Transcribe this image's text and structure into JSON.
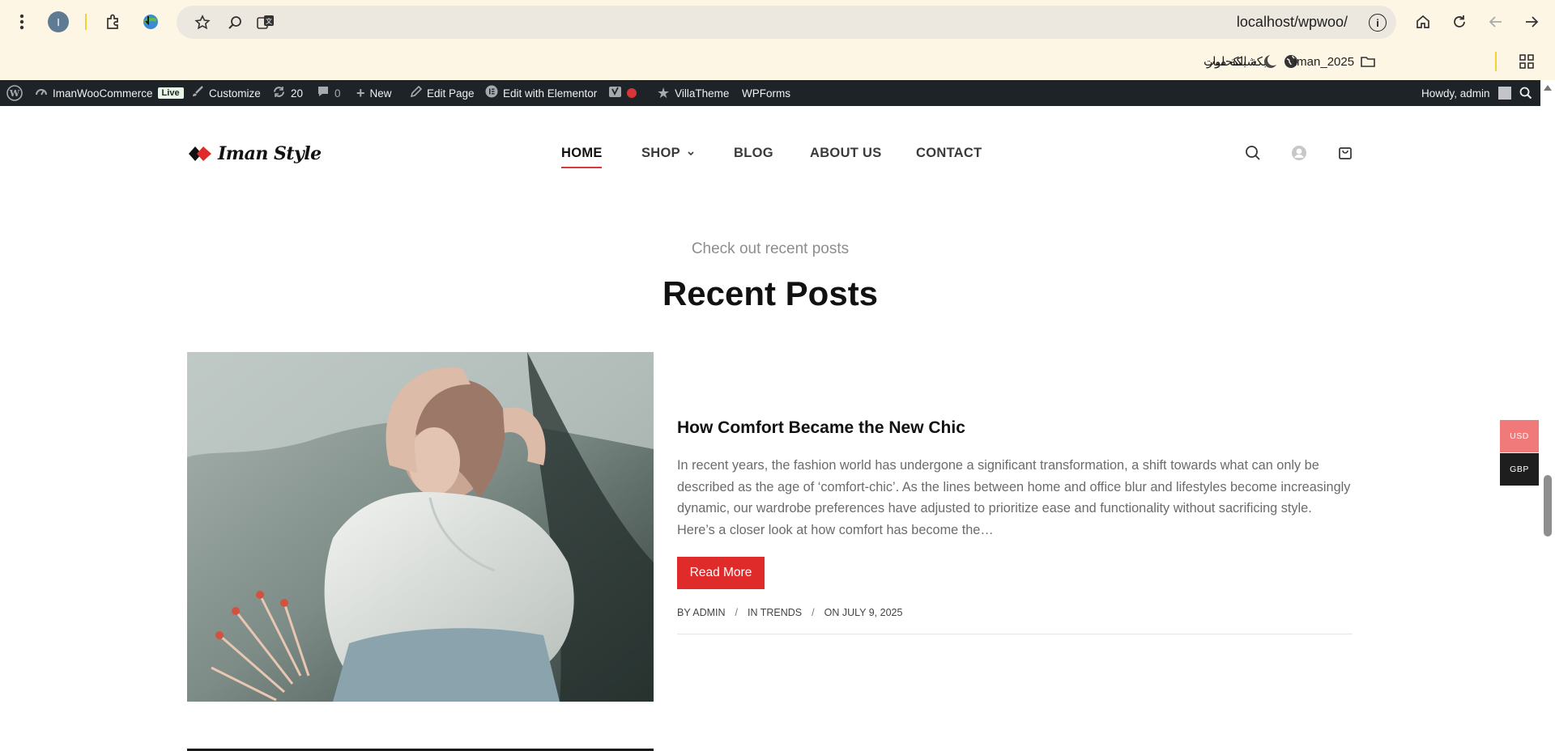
{
  "browser": {
    "url": "localhost/wpwoo/",
    "profile_initial": "I",
    "bookmarks": [
      {
        "label": "شبكة الكحلوت"
      },
      {
        "label": "Iman_2025"
      },
      {
        "label": "شبكة ميار"
      }
    ]
  },
  "adminbar": {
    "site_name": "ImanWooCommerce",
    "live_badge": "Live",
    "customize": "Customize",
    "updates_count": "20",
    "comments_count": "0",
    "new": "New",
    "edit_page": "Edit Page",
    "edit_elementor": "Edit with Elementor",
    "villatheme": "VillaTheme",
    "wpforms": "WPForms",
    "howdy": "Howdy, admin"
  },
  "site": {
    "logo_text": "Iman Style",
    "nav": {
      "home": "HOME",
      "shop": "SHOP",
      "blog": "BLOG",
      "about": "ABOUT US",
      "contact": "CONTACT"
    }
  },
  "section": {
    "subtitle": "Check out recent posts",
    "title": "Recent Posts"
  },
  "post": {
    "title": "How Comfort Became the New Chic",
    "excerpt": "In recent years, the fashion world has undergone a significant transformation, a shift towards what can only be described as the age of ‘comfort-chic’. As the lines between home and office blur and lifestyles become increasingly dynamic, our wardrobe preferences have adjusted to prioritize ease and functionality without sacrificing style. Here’s a closer look at how comfort has become the…",
    "read_more": "Read More",
    "meta_author": "BY ADMIN",
    "meta_category": "IN TRENDS",
    "meta_date": "ON JULY 9, 2025"
  },
  "currency": {
    "usd": "USD",
    "gbp": "GBP",
    "usd_color": "#f07a7a",
    "gbp_color": "#1e1e1e"
  },
  "colors": {
    "accent": "#e02b2b",
    "adminbar": "#1d2327",
    "chrome_bg": "#fdf6e4"
  }
}
